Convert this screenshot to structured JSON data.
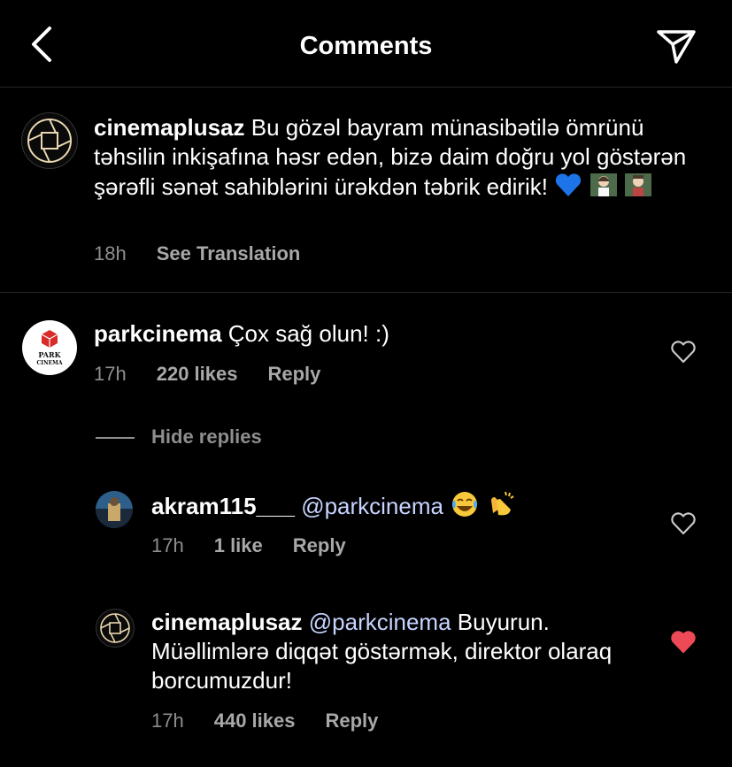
{
  "header": {
    "title": "Comments"
  },
  "caption": {
    "username": "cinemaplusaz",
    "text": "Bu gözəl bayram münasibətilə ömrünü təhsilin inkişafına həsr edən, bizə daim doğru yol göstərən şərəfli sənət sahiblərini ürəkdən təbrik edirik!",
    "time": "18h",
    "translate": "See Translation"
  },
  "comments": [
    {
      "username": "parkcinema",
      "text": "Çox sağ olun! :)",
      "time": "17h",
      "likes": "220 likes",
      "reply": "Reply",
      "liked": false,
      "avatar_label_top": "PARK",
      "avatar_label_bottom": "CINEMA"
    }
  ],
  "replies_toggle": "Hide replies",
  "replies": [
    {
      "username": "akram115___",
      "mention": "@parkcinema",
      "text": "",
      "time": "17h",
      "likes": "1 like",
      "reply": "Reply",
      "liked": false
    },
    {
      "username": "cinemaplusaz",
      "mention": "@parkcinema",
      "text": "Buyurun. Müəllimlərə diqqət göstərmək, direktor olaraq borcumuzdur!",
      "time": "17h",
      "likes": "440 likes",
      "reply": "Reply",
      "liked": true
    }
  ],
  "colors": {
    "background": "#000000",
    "meta": "#8e8e8e",
    "mention": "#c7d4ff",
    "liked_heart": "#ed4956",
    "park_red": "#d92b27"
  },
  "icons": [
    "back-chevron-icon",
    "send-paper-plane-icon",
    "heart-outline-icon",
    "heart-filled-icon"
  ]
}
